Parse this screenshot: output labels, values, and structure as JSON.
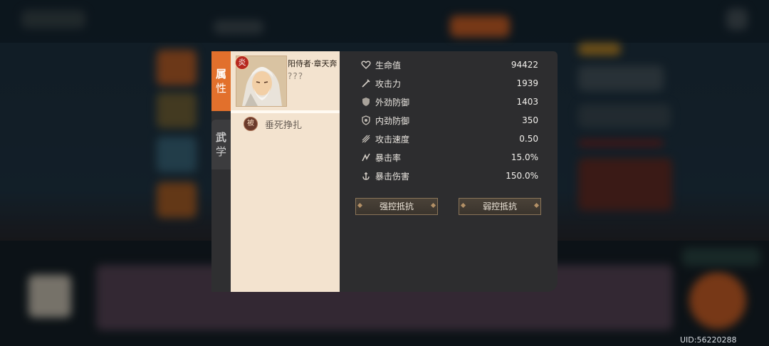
{
  "tabs": [
    {
      "char1": "属",
      "char2": "性",
      "active": true
    },
    {
      "char1": "武",
      "char2": "学",
      "active": false
    }
  ],
  "hero": {
    "element_badge": "炎",
    "name": "阳侍者·章天奔",
    "subtitle": "???"
  },
  "skill": {
    "icon_text": "被",
    "name": "垂死挣扎"
  },
  "stats": [
    {
      "icon": "heart-icon",
      "label": "生命值",
      "value": "94422"
    },
    {
      "icon": "sword-icon",
      "label": "攻击力",
      "value": "1939"
    },
    {
      "icon": "shield-icon",
      "label": "外劲防御",
      "value": "1403"
    },
    {
      "icon": "inner-shield-icon",
      "label": "内劲防御",
      "value": "350"
    },
    {
      "icon": "speed-icon",
      "label": "攻击速度",
      "value": "0.50"
    },
    {
      "icon": "crit-icon",
      "label": "暴击率",
      "value": "15.0%"
    },
    {
      "icon": "anchor-icon",
      "label": "暴击伤害",
      "value": "150.0%"
    }
  ],
  "buttons": {
    "strong_control": "强控抵抗",
    "weak_control": "弱控抵抗"
  },
  "uid": "UID:56220288",
  "colors": {
    "accent": "#e2702c",
    "hero_panel": "#f3e3cf",
    "stats_panel": "#2d2d2f"
  }
}
